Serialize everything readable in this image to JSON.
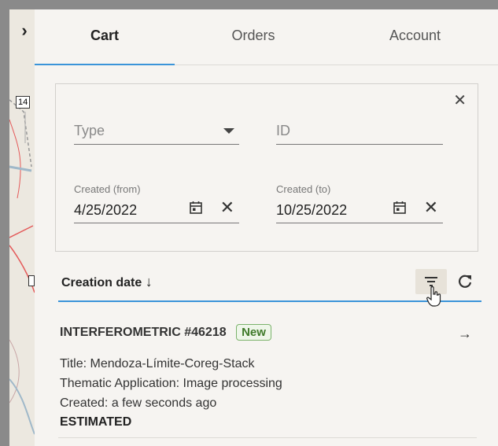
{
  "tabs": [
    {
      "label": "Cart"
    },
    {
      "label": "Orders"
    },
    {
      "label": "Account"
    }
  ],
  "map": {
    "label": "14"
  },
  "filters": {
    "type_placeholder": "Type",
    "id_placeholder": "ID",
    "created_from_label": "Created (from)",
    "created_from_value": "4/25/2022",
    "created_to_label": "Created (to)",
    "created_to_value": "10/25/2022"
  },
  "sort": {
    "label": "Creation date",
    "direction_glyph": "↓"
  },
  "item": {
    "title": "INTERFEROMETRIC #46218",
    "badge": "New",
    "line_title": "Title: Mendoza-Límite-Coreg-Stack",
    "line_app": "Thematic Application: Image processing",
    "line_created": "Created: a few seconds ago",
    "status": "ESTIMATED"
  },
  "colors": {
    "accent": "#3b94d9",
    "badge_green": "#3f7a2a"
  },
  "icons": [
    "chevron-right-icon",
    "close-icon",
    "dropdown-arrow-icon",
    "calendar-icon",
    "filter-icon",
    "refresh-icon",
    "arrow-right-icon",
    "hand-cursor-icon"
  ]
}
